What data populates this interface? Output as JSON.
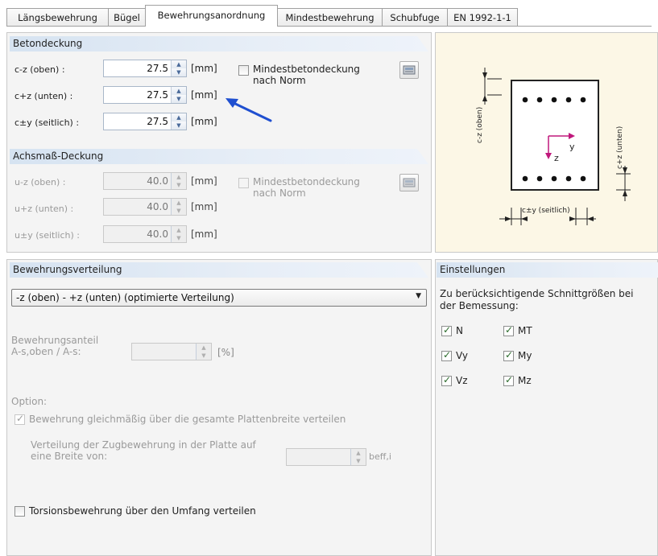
{
  "tabs": [
    {
      "label": "Längsbewehrung"
    },
    {
      "label": "Bügel"
    },
    {
      "label": "Bewehrungsanordnung"
    },
    {
      "label": "Mindestbewehrung"
    },
    {
      "label": "Schubfuge"
    },
    {
      "label": "EN 1992-1-1"
    }
  ],
  "betondeckung": {
    "title": "Betondeckung",
    "rows": [
      {
        "label": "c-z (oben) :",
        "value": "27.5",
        "unit": "[mm]"
      },
      {
        "label": "c+z (unten) :",
        "value": "27.5",
        "unit": "[mm]"
      },
      {
        "label": "c±y (seitlich) :",
        "value": "27.5",
        "unit": "[mm]"
      }
    ],
    "checkbox_label_1": "Mindestbetondeckung",
    "checkbox_label_2": "nach Norm"
  },
  "achsmass": {
    "title": "Achsmaß-Deckung",
    "rows": [
      {
        "label": "u-z (oben) :",
        "value": "40.0",
        "unit": "[mm]"
      },
      {
        "label": "u+z (unten) :",
        "value": "40.0",
        "unit": "[mm]"
      },
      {
        "label": "u±y (seitlich) :",
        "value": "40.0",
        "unit": "[mm]"
      }
    ],
    "checkbox_label_1": "Mindestbetondeckung",
    "checkbox_label_2": "nach Norm"
  },
  "diagram": {
    "c_top": "c-z (oben)",
    "c_bottom": "c+z (unten)",
    "c_side": "c±y (seitlich)",
    "axis_y": "y",
    "axis_z": "z"
  },
  "verteilung": {
    "title": "Bewehrungsverteilung",
    "dropdown_value": "-z (oben) - +z (unten) (optimierte Verteilung)",
    "anteil_label_1": "Bewehrungsanteil",
    "anteil_label_2": "A-s,oben / A-s:",
    "anteil_unit": "[%]",
    "option_label": "Option:",
    "gleichmaessig": "Bewehrung gleichmäßig über die gesamte Plattenbreite verteilen",
    "zug_label_1": "Verteilung der Zugbewehrung in der Platte auf",
    "zug_label_2": "eine Breite von:",
    "beff_unit": "beff,i",
    "torsion": "Torsionsbewehrung über den Umfang verteilen"
  },
  "einstellungen": {
    "title": "Einstellungen",
    "desc_1": "Zu berücksichtigende Schnittgrößen bei",
    "desc_2": "der Bemessung:",
    "items": [
      {
        "label": "N",
        "checked": true
      },
      {
        "label": "MT",
        "checked": true
      },
      {
        "label": "Vy",
        "checked": true
      },
      {
        "label": "My",
        "checked": true
      },
      {
        "label": "Vz",
        "checked": true
      },
      {
        "label": "Mz",
        "checked": true
      }
    ]
  },
  "colors": {
    "arrow": "#1f4fd0",
    "section_header": "#d6e3f1",
    "diagram_bg": "#fcf7e6"
  }
}
